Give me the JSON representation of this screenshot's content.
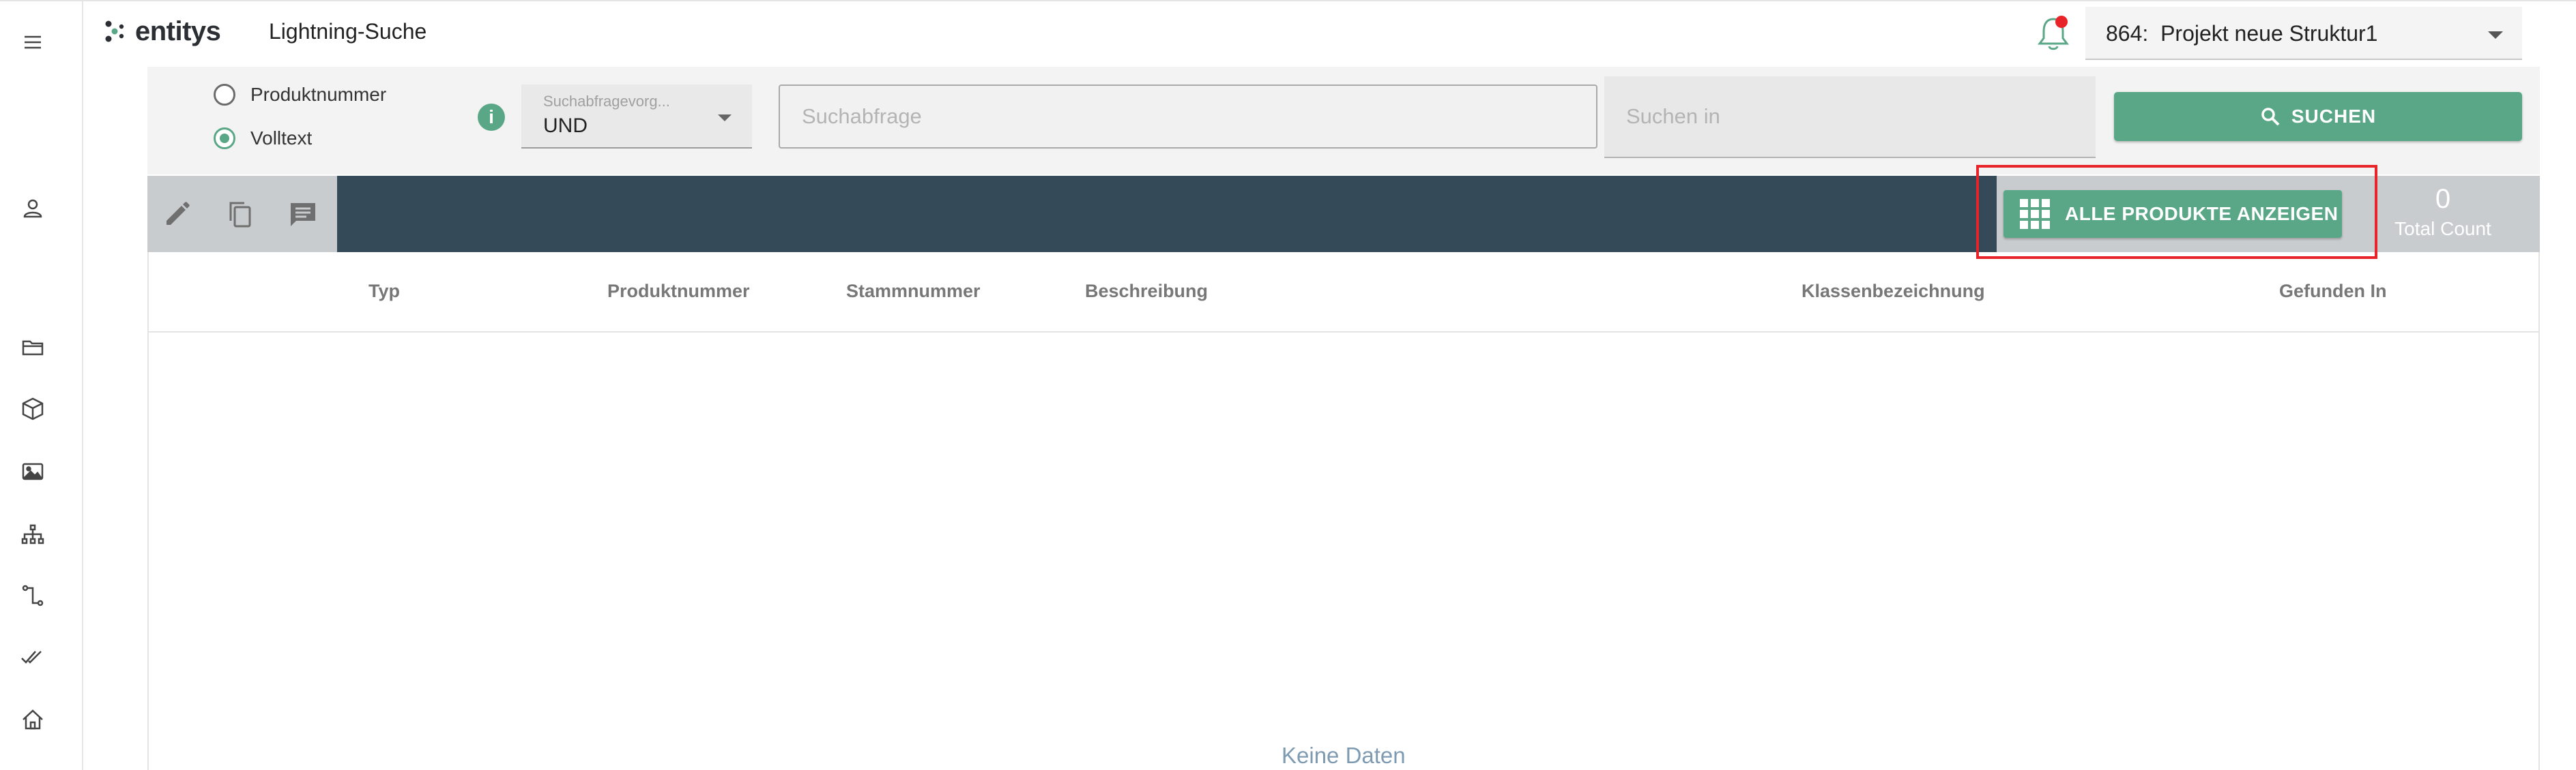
{
  "header": {
    "logo_text": "entitys",
    "app_title": "Lightning-Suche",
    "project_selector": "864:  Projekt neue Struktur1"
  },
  "colors": {
    "accent": "#5aa787",
    "toolbar_dark": "#344a58",
    "toolbar_grey": "#c9ccce",
    "highlight": "#e8232a",
    "bell_dot": "#e8232a"
  },
  "sidebar": {
    "icons": [
      "menu-icon",
      "user-icon",
      "folder-icon",
      "cube-icon",
      "image-icon",
      "hierarchy-icon",
      "connector-icon",
      "double-check-icon",
      "home-icon"
    ]
  },
  "search": {
    "radio_options": [
      {
        "label": "Produktnummer",
        "checked": false
      },
      {
        "label": "Volltext",
        "checked": true
      }
    ],
    "operator_label": "Suchabfragevorg...",
    "operator_value": "UND",
    "query_placeholder": "Suchabfrage",
    "search_in_placeholder": "Suchen in",
    "search_button": "SUCHEN"
  },
  "toolbar": {
    "show_all_button": "ALLE PRODUKTE ANZEIGEN",
    "total_count_value": "0",
    "total_count_label": "Total Count"
  },
  "table": {
    "columns": [
      "Typ",
      "Produktnummer",
      "Stammnummer",
      "Beschreibung",
      "Klassenbezeichnung",
      "Gefunden In"
    ],
    "empty_text": "Keine Daten"
  }
}
